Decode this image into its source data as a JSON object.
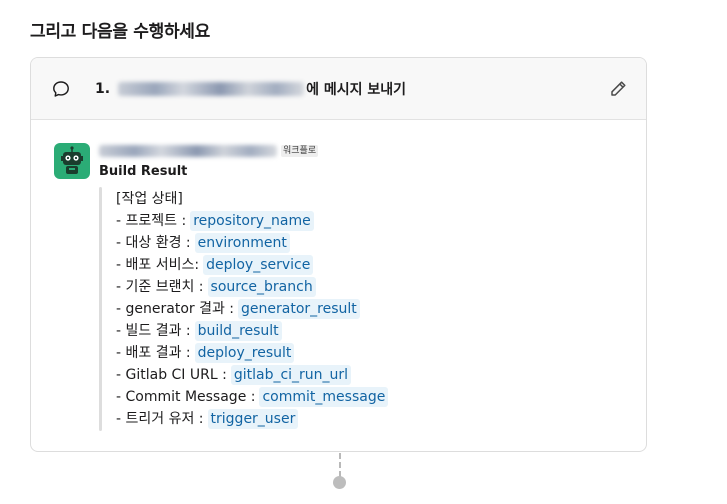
{
  "section": {
    "title": "그리고 다음을 수행하세요"
  },
  "step": {
    "number": "1.",
    "suffix": "에 메시지 보내기",
    "edit_icon": "pencil-icon",
    "type_icon": "speech-bubble-icon"
  },
  "message": {
    "workflow_badge": "워크플로",
    "title": "Build Result",
    "avatar_color": "#2bac76",
    "avatar_icon": "robot-icon",
    "lines": [
      {
        "label": "[작업 상태]",
        "variable": ""
      },
      {
        "label": "- 프로젝트 :",
        "variable": "repository_name"
      },
      {
        "label": "- 대상 환경 :",
        "variable": "environment"
      },
      {
        "label": "- 배포 서비스:",
        "variable": "deploy_service"
      },
      {
        "label": "- 기준 브랜치 :",
        "variable": "source_branch"
      },
      {
        "label": "- generator 결과 :",
        "variable": "generator_result"
      },
      {
        "label": "- 빌드 결과 :",
        "variable": "build_result"
      },
      {
        "label": "- 배포 결과 :",
        "variable": "deploy_result"
      },
      {
        "label": "- Gitlab CI URL :",
        "variable": "gitlab_ci_run_url"
      },
      {
        "label": "- Commit Message :",
        "variable": "commit_message"
      },
      {
        "label": "- 트리거 유저 :",
        "variable": "trigger_user"
      }
    ]
  },
  "colors": {
    "variable_bg": "#e8f3fa",
    "variable_text": "#1264a3"
  }
}
